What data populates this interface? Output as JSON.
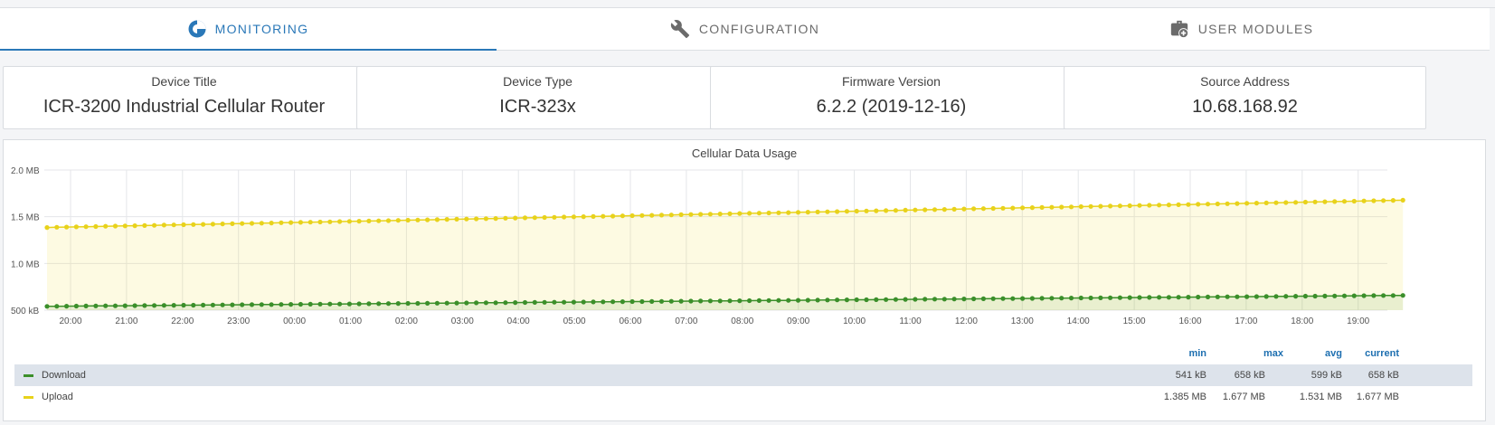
{
  "tabs": [
    {
      "label": "MONITORING",
      "icon": "monitoring-pie-icon",
      "active": true
    },
    {
      "label": "CONFIGURATION",
      "icon": "wrench-icon",
      "active": false
    },
    {
      "label": "USER MODULES",
      "icon": "briefcase-plus-icon",
      "active": false
    }
  ],
  "cards": [
    {
      "label": "Device Title",
      "value": "ICR-3200 Industrial Cellular Router"
    },
    {
      "label": "Device Type",
      "value": "ICR-323x"
    },
    {
      "label": "Firmware Version",
      "value": "6.2.2 (2019-12-16)"
    },
    {
      "label": "Source Address",
      "value": "10.68.168.92"
    }
  ],
  "chart": {
    "title": "Cellular Data Usage",
    "legend_headers": [
      "min",
      "max",
      "avg",
      "current"
    ],
    "series": [
      {
        "name": "Download",
        "color": "#3b8f2a",
        "stats": [
          "541 kB",
          "658 kB",
          "599 kB",
          "658 kB"
        ]
      },
      {
        "name": "Upload",
        "color": "#e8d21b",
        "stats": [
          "1.385 MB",
          "1.677 MB",
          "1.531 MB",
          "1.677 MB"
        ]
      }
    ]
  },
  "chart_data": {
    "type": "area",
    "title": "Cellular Data Usage",
    "y_tick_labels": [
      "500 kB",
      "1.0 MB",
      "1.5 MB",
      "2.0 MB"
    ],
    "ylim_kb": [
      500,
      2000
    ],
    "x_tick_labels": [
      "20:00",
      "21:00",
      "22:00",
      "23:00",
      "00:00",
      "01:00",
      "02:00",
      "03:00",
      "04:00",
      "05:00",
      "06:00",
      "07:00",
      "08:00",
      "09:00",
      "10:00",
      "11:00",
      "12:00",
      "13:00",
      "14:00",
      "15:00",
      "16:00",
      "17:00",
      "18:00",
      "19:00"
    ],
    "x_start_offset_hours": -0.42,
    "x_end_offset_hours": 23.8,
    "points_per_series": 140,
    "series": [
      {
        "name": "Download",
        "color": "#3b8f2a",
        "start_kb": 541,
        "end_kb": 658
      },
      {
        "name": "Upload",
        "color": "#e8d21b",
        "start_kb": 1385,
        "end_kb": 1677
      }
    ],
    "grid": true,
    "legend": "bottom"
  }
}
